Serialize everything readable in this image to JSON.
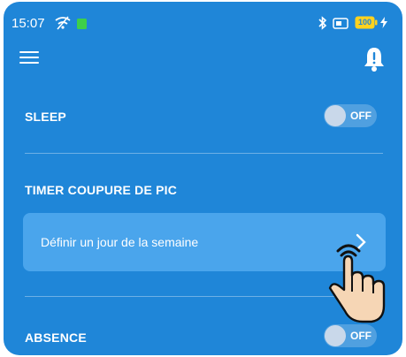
{
  "status_bar": {
    "time": "15:07",
    "battery_level": "100",
    "icons": [
      "wifi-off-icon",
      "sim-icon",
      "bluetooth-icon",
      "screen-icon",
      "battery-icon",
      "charging-icon"
    ]
  },
  "app_bar": {
    "menu_icon": "menu-icon",
    "notification_icon": "bell-alert-icon"
  },
  "sections": {
    "sleep": {
      "title": "SLEEP",
      "toggle_label": "OFF",
      "enabled": false
    },
    "timer": {
      "title": "TIMER COUPURE DE PIC",
      "option_label": "Définir un jour de la semaine",
      "option_icon": "chevron-right-icon"
    },
    "absence": {
      "title": "ABSENCE",
      "toggle_label": "OFF",
      "enabled": false
    }
  },
  "overlay": {
    "pointer_icon": "tap-hand-icon"
  },
  "colors": {
    "background": "#1f86d8",
    "card": "#4aa5ec",
    "toggle_knob": "#c9d8ea",
    "text": "#ffffff"
  }
}
